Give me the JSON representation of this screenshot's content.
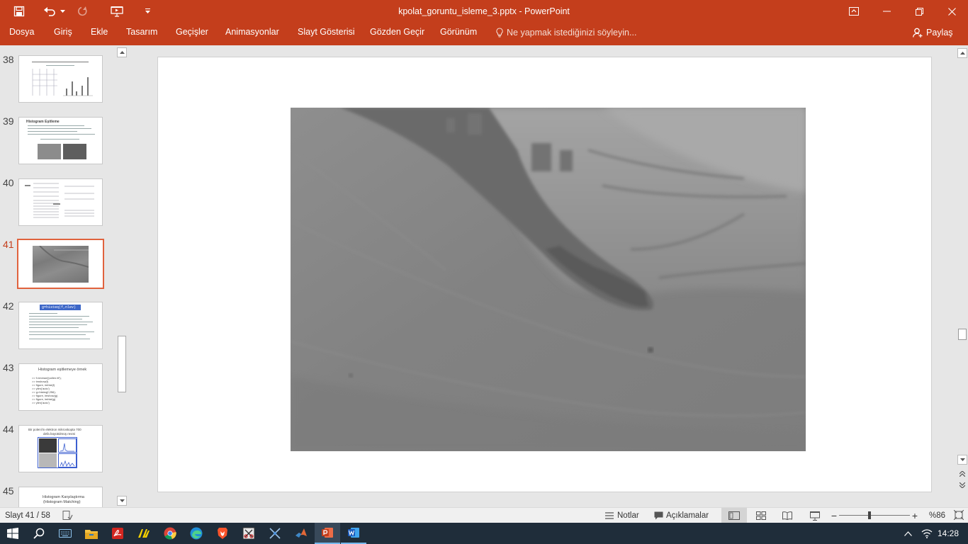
{
  "app": {
    "window_title": "kpolat_goruntu_isleme_3.pptx - PowerPoint",
    "brand_color": "#c43e1c",
    "accent_border": "#e0623d"
  },
  "quick_access": {
    "icons": [
      "save-icon",
      "undo-icon",
      "redo-icon",
      "start-from-beginning-icon",
      "customize-icon"
    ]
  },
  "window_controls": [
    "ribbon-display-options-icon",
    "minimize-icon",
    "restore-icon",
    "close-icon"
  ],
  "ribbon": {
    "tabs": [
      "Dosya",
      "Giriş",
      "Ekle",
      "Tasarım",
      "Geçişler",
      "Animasyonlar",
      "Slayt Gösterisi",
      "Gözden Geçir",
      "Görünüm"
    ],
    "tell_me": "Ne yapmak istediğinizi söyleyin...",
    "share": "Paylaş"
  },
  "thumbnails": [
    {
      "number": "38",
      "active": false
    },
    {
      "number": "39",
      "active": false,
      "title": "Histogram Eşitleme"
    },
    {
      "number": "40",
      "active": false
    },
    {
      "number": "41",
      "active": true
    },
    {
      "number": "42",
      "active": false,
      "code": "g=histeq(f,nlev)"
    },
    {
      "number": "43",
      "active": false,
      "title": "Histogram eşitlemeye örnek",
      "lines": [
        ">> f=imread('pollen.tif');",
        ">> imshow(f)",
        ">> figure, imhist(f)",
        ">> ylim('auto')",
        ">> g=histeq(f,256);",
        ">> figure, imshow(g)",
        ">> figure, imhist(g)",
        ">> ylim('auto')"
      ]
    },
    {
      "number": "44",
      "active": false,
      "title_line1": "Bir poleni'in elektron mikroskopta 700",
      "title_line2": "defa büyütülmüş resmi"
    },
    {
      "number": "45",
      "active": false,
      "title_line1": "Histogram Karşılaştırma",
      "title_line2": "(Histogram Matching)"
    }
  ],
  "status": {
    "slide_info": "Slayt 41 / 58",
    "notes": "Notlar",
    "comments": "Açıklamalar",
    "zoom": "%86",
    "zoom_level": 0.43
  },
  "taskbar": {
    "icons": [
      "windows-start-icon",
      "search-icon",
      "touch-keyboard-icon",
      "file-explorer-icon",
      "acrobat-icon",
      "norton-icon",
      "chrome-icon",
      "edge-icon",
      "brave-icon",
      "snipping-tool-icon",
      "network-tool-icon",
      "matlab-icon",
      "powerpoint-icon",
      "word-icon"
    ],
    "time": "14:28"
  }
}
